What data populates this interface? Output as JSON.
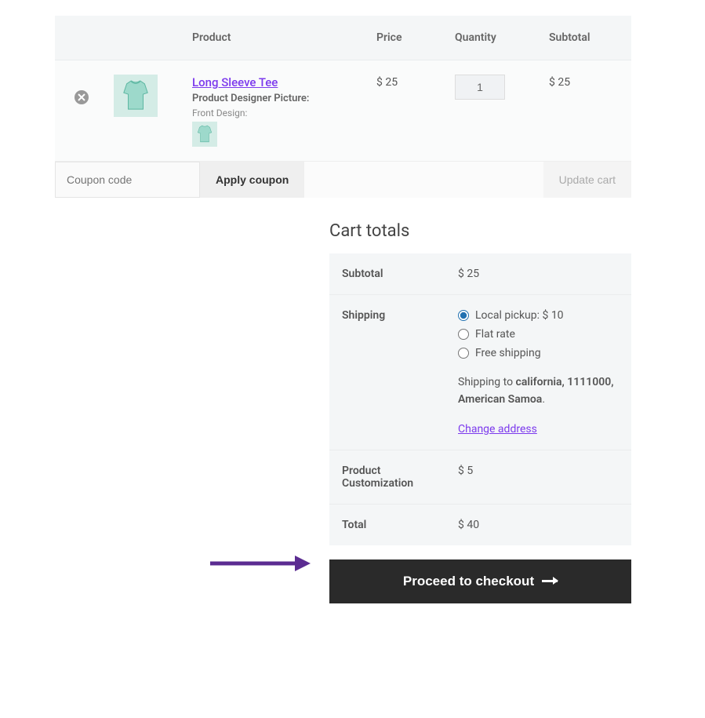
{
  "cart": {
    "headers": {
      "product": "Product",
      "price": "Price",
      "quantity": "Quantity",
      "subtotal": "Subtotal"
    },
    "items": [
      {
        "name": "Long Sleeve Tee",
        "designer_label": "Product Designer Picture:",
        "front_design_label": "Front Design:",
        "price": "$ 25",
        "quantity": "1",
        "subtotal": "$ 25"
      }
    ],
    "coupon_placeholder": "Coupon code",
    "apply_coupon_label": "Apply coupon",
    "update_cart_label": "Update cart"
  },
  "totals": {
    "title": "Cart totals",
    "subtotal_label": "Subtotal",
    "subtotal_value": "$ 25",
    "shipping_label": "Shipping",
    "shipping_options": [
      {
        "label": "Local pickup: $ 10",
        "checked": true
      },
      {
        "label": "Flat rate",
        "checked": false
      },
      {
        "label": "Free shipping",
        "checked": false
      }
    ],
    "shipping_to_prefix": "Shipping to ",
    "shipping_destination": "california, 1111000, American Samoa",
    "shipping_destination_suffix": ".",
    "change_address_label": "Change address",
    "customization_label": "Product Customization",
    "customization_value": "$ 5",
    "total_label": "Total",
    "total_value": "$ 40",
    "checkout_label": "Proceed to checkout"
  }
}
